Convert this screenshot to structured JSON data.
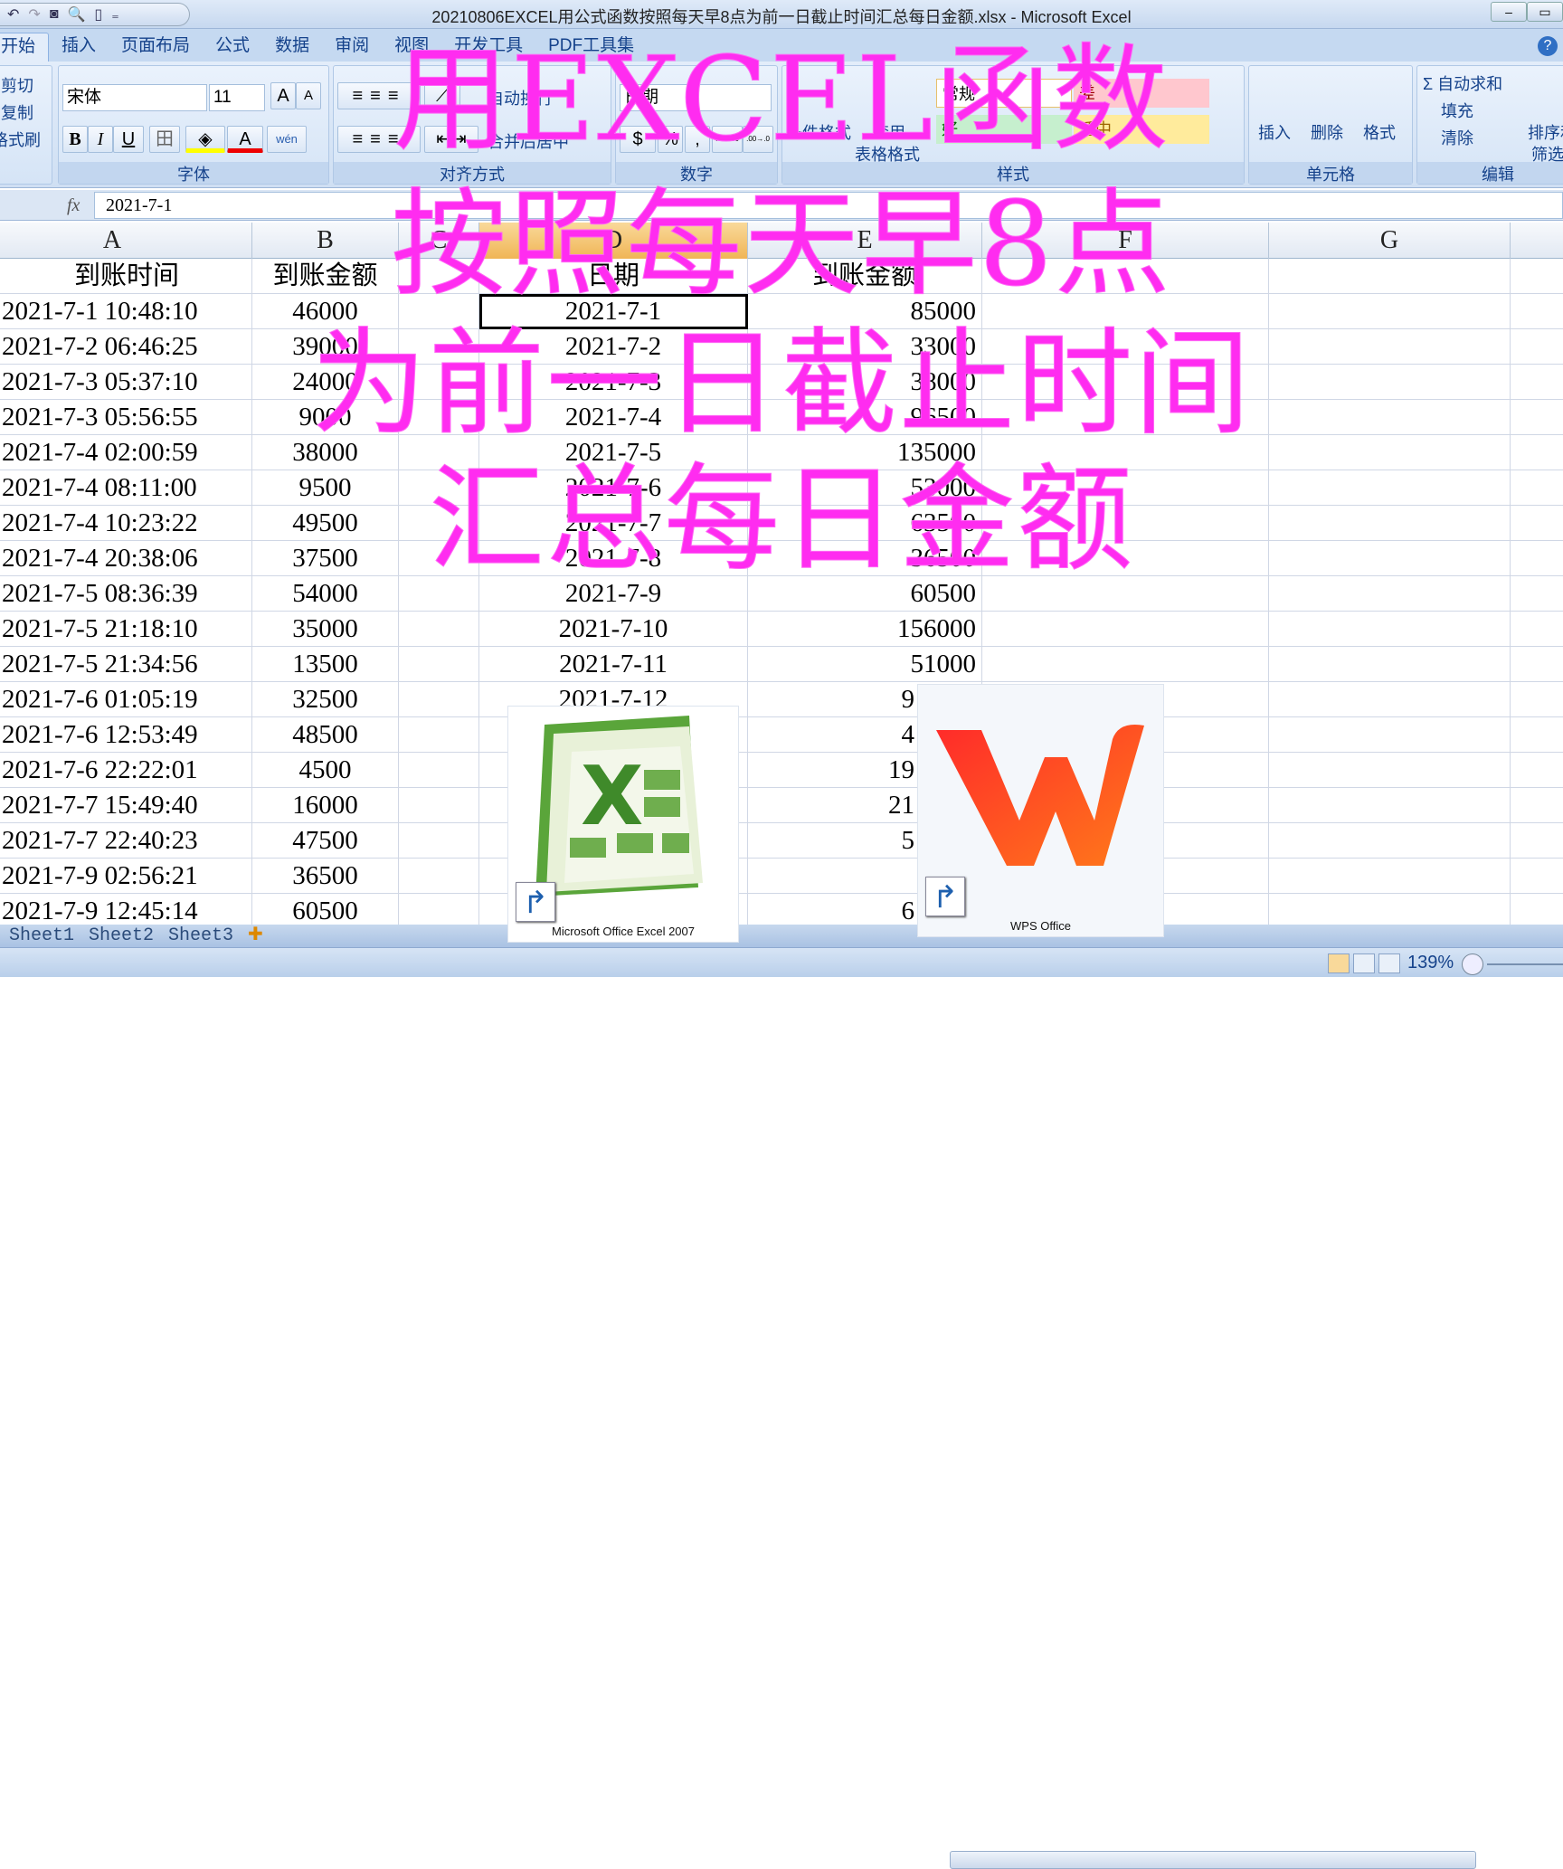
{
  "window": {
    "title": "20210806EXCEL用公式函数按照每天早8点为前一日截止时间汇总每日金额.xlsx - Microsoft Excel",
    "min": "–",
    "max": "▭"
  },
  "qat": {
    "undo": "↶",
    "redo": "↷",
    "camera": "◙",
    "preview": "🔍",
    "new": "▯",
    "more": "₌"
  },
  "tabs": [
    "开始",
    "插入",
    "页面布局",
    "公式",
    "数据",
    "审阅",
    "视图",
    "开发工具",
    "PDF工具集"
  ],
  "ribbon": {
    "clipboard": {
      "cut": "剪切",
      "copy": "复制",
      "format_painter": "格式刷"
    },
    "font": {
      "label": "字体",
      "name": "宋体",
      "size": "11",
      "grow": "A",
      "shrink": "A",
      "bold": "B",
      "italic": "I",
      "underline": "U",
      "border": "田",
      "fill": "◈",
      "color": "A",
      "phonetic": "wén"
    },
    "align": {
      "label": "对齐方式",
      "wrap": "自动换行",
      "merge": "合并后居中"
    },
    "number": {
      "label": "数字",
      "format": "日期",
      "currency": "$",
      "percent": "%",
      "comma": ",",
      "inc": ".0→.00",
      "dec": ".00→.0"
    },
    "styles": {
      "label": "样式",
      "conditional": "条件格式",
      "table": "套用",
      "table2": "表格格式",
      "normal": "常规",
      "bad": "差",
      "good": "好",
      "neutral": "适中"
    },
    "cells": {
      "label": "单元格",
      "insert": "插入",
      "delete": "删除",
      "format": "格式"
    },
    "editing": {
      "label": "编辑",
      "autosum": "自动求和",
      "fill": "填充",
      "clear": "清除",
      "sort": "排序和",
      "filter": "筛选"
    }
  },
  "formula_bar": {
    "fx": "fx",
    "value": "2021-7-1"
  },
  "columns": [
    "A",
    "B",
    "C",
    "D",
    "E",
    "F",
    "G"
  ],
  "headers": {
    "A": "到账时间",
    "B": "到账金额",
    "D": "日期",
    "E": "到账金额"
  },
  "rows": [
    [
      "2021-7-1 10:48:10",
      "46000",
      "2021-7-1",
      "85000"
    ],
    [
      "2021-7-2 06:46:25",
      "39000",
      "2021-7-2",
      "33000"
    ],
    [
      "2021-7-3 05:37:10",
      "24000",
      "2021-7-3",
      "38000"
    ],
    [
      "2021-7-3 05:56:55",
      "9000",
      "2021-7-4",
      "96500"
    ],
    [
      "2021-7-4 02:00:59",
      "38000",
      "2021-7-5",
      "135000"
    ],
    [
      "2021-7-4 08:11:00",
      "9500",
      "2021-7-6",
      "53000"
    ],
    [
      "2021-7-4 10:23:22",
      "49500",
      "2021-7-7",
      "63500"
    ],
    [
      "2021-7-4 20:38:06",
      "37500",
      "2021-7-8",
      "36500"
    ],
    [
      "2021-7-5 08:36:39",
      "54000",
      "2021-7-9",
      "60500"
    ],
    [
      "2021-7-5 21:18:10",
      "35000",
      "2021-7-10",
      "156000"
    ],
    [
      "2021-7-5 21:34:56",
      "13500",
      "2021-7-11",
      "51000"
    ],
    [
      "2021-7-6 01:05:19",
      "32500",
      "2021-7-12",
      "9"
    ],
    [
      "2021-7-6 12:53:49",
      "48500",
      "",
      "4"
    ],
    [
      "2021-7-6 22:22:01",
      "4500",
      "",
      "19"
    ],
    [
      "2021-7-7 15:49:40",
      "16000",
      "",
      "21"
    ],
    [
      "2021-7-7 22:40:23",
      "47500",
      "",
      "5"
    ],
    [
      "2021-7-9 02:56:21",
      "36500",
      "",
      ""
    ],
    [
      "2021-7-9 12:45:14",
      "60500",
      "",
      "6"
    ]
  ],
  "overlay_title": [
    "用EXCEL函数",
    "按照每天早8点",
    "为前一日截止时间",
    "汇总每日金额"
  ],
  "overlay_color": "#ff2cf0",
  "shortcuts": [
    {
      "label": "Microsoft Office Excel 2007",
      "icon": "excel-2007-icon"
    },
    {
      "label": "WPS Office",
      "icon": "wps-office-icon"
    }
  ],
  "sheet_tabs": [
    "Sheet1",
    "Sheet2",
    "Sheet3"
  ],
  "status": {
    "zoom": "139%"
  }
}
